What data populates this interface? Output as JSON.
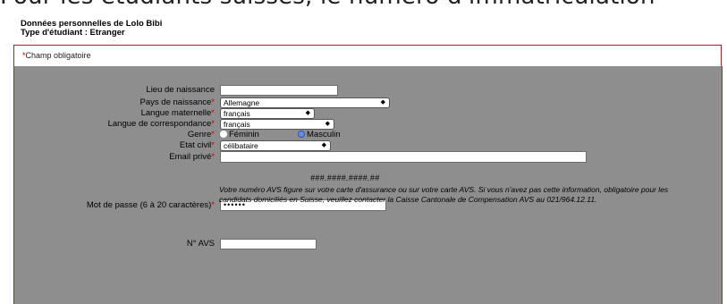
{
  "banner": {
    "text": "Pour les étudiants suisses, le numéro d'immatriculation"
  },
  "header": {
    "line1": "Données personnelles de Lolo Bibi",
    "line2": "Type d'étudiant : Etranger"
  },
  "required_note": {
    "star": "*",
    "text": "Champ obligatoire"
  },
  "form": {
    "lieu_naissance": {
      "label": "Lieu de naissance",
      "value": ""
    },
    "pays_naissance": {
      "label": "Pays de naissance",
      "value": "Allemagne"
    },
    "langue_maternelle": {
      "label": "Langue maternelle",
      "value": "français"
    },
    "langue_correspondance": {
      "label": "Langue de correspondance",
      "value": "français"
    },
    "genre": {
      "label": "Genre",
      "option1": "Féminin",
      "option2": "Masculin",
      "selected": "Masculin"
    },
    "etat_civil": {
      "label": "Etat civil",
      "value": "célibataire"
    },
    "email": {
      "label": "Email privé",
      "value": ""
    },
    "password": {
      "label": "Mot de passe (6 à 20 caractères)",
      "value": "••••••"
    },
    "avs": {
      "label": "N° AVS",
      "value": "",
      "format": "###.####.####.##",
      "help": "Votre numéro AVS figure sur votre carte d'assurance ou sur votre carte AVS. Si vous n'avez pas cette information, obligatoire pour les candidats domiciliés en Suisse, veuillez contacter la Caisse Cantonale de Compensation AVS au 021/964.12.11."
    },
    "required_star": "*",
    "select_arrows": "◆"
  },
  "colors": {
    "panel": "#8e8e8e",
    "required": "#d40000",
    "border": "#b51d1d",
    "radio_selected": "#2b54c4"
  }
}
